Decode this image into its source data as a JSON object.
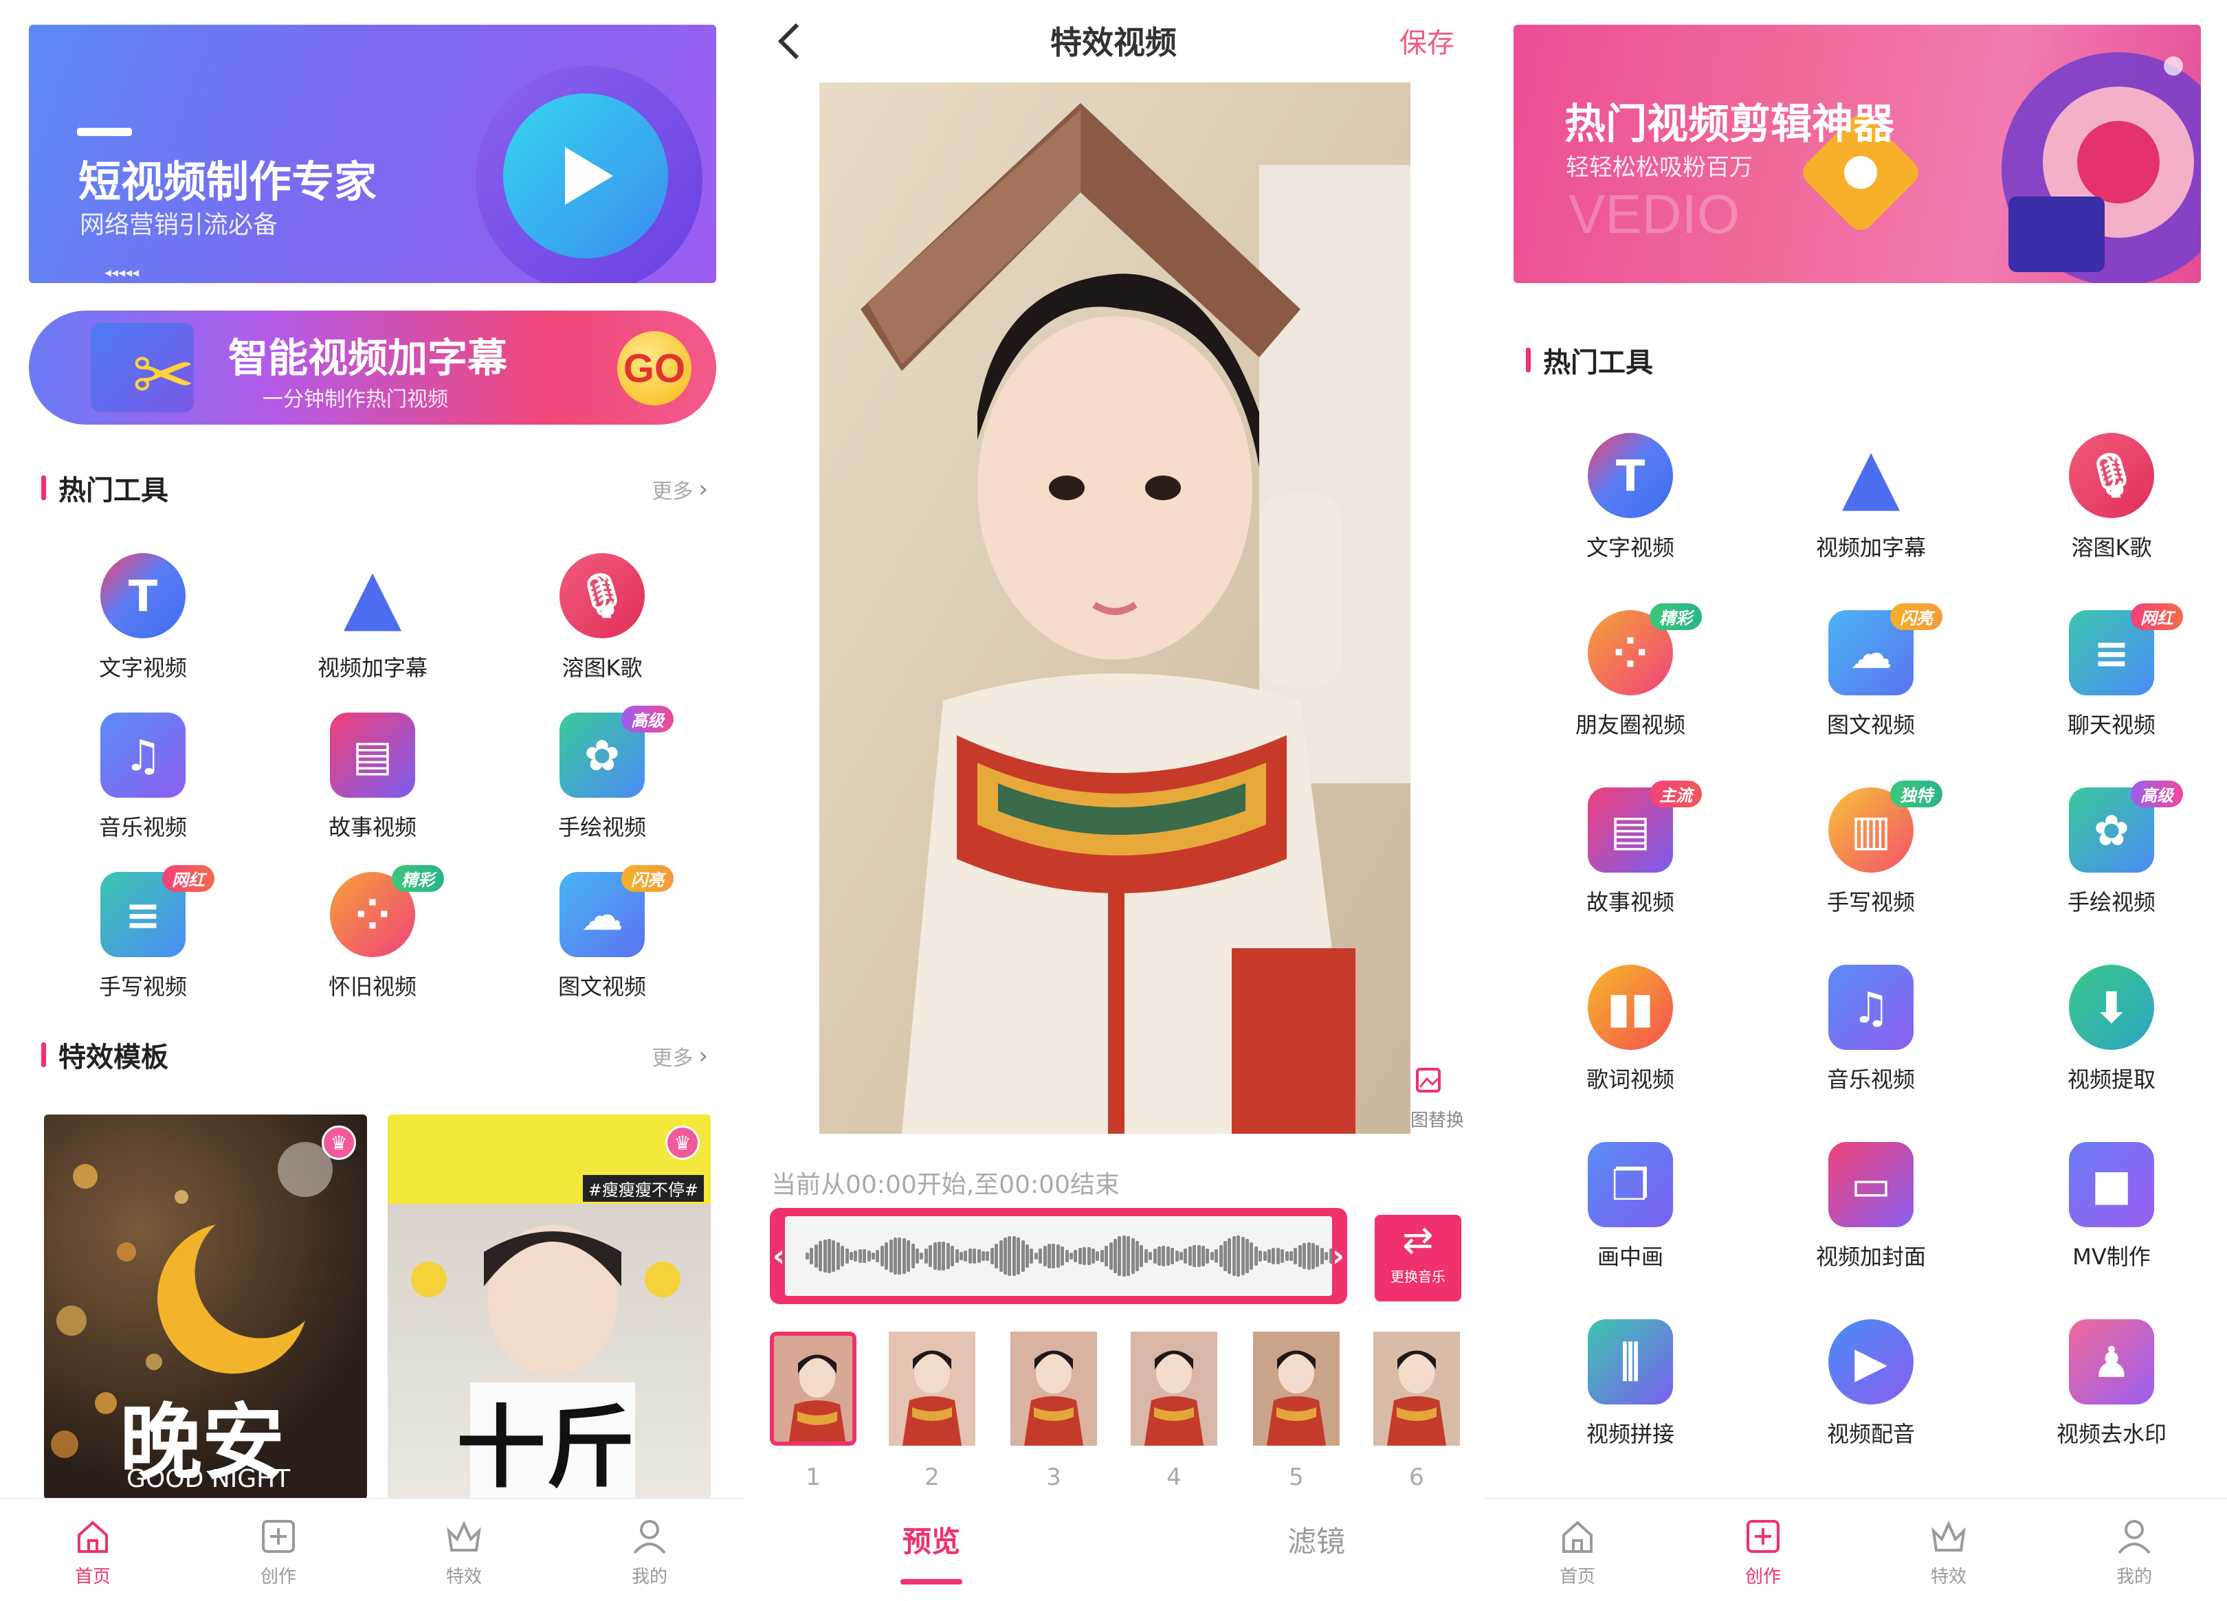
{
  "colors": {
    "accent": "#f0316b",
    "text": "#222222",
    "muted": "#999999"
  },
  "left": {
    "banner": {
      "title": "短视频制作专家",
      "subtitle": "网络营销引流必备",
      "arrows": "◂◂◂◂◂"
    },
    "subtitle_button": {
      "title": "智能视频加字幕",
      "subtitle": "一分钟制作热门视频",
      "go": "GO"
    },
    "hot_tools": {
      "title": "热门工具",
      "more": "更多",
      "items": [
        {
          "label": "文字视频",
          "icon": "text-icon"
        },
        {
          "label": "视频加字幕",
          "icon": "subtitle-icon"
        },
        {
          "label": "溶图K歌",
          "icon": "karaoke-icon"
        },
        {
          "label": "音乐视频",
          "icon": "music-note-icon"
        },
        {
          "label": "故事视频",
          "icon": "book-icon"
        },
        {
          "label": "手绘视频",
          "icon": "paint-icon",
          "tag": "高级"
        },
        {
          "label": "手写视频",
          "icon": "list-icon",
          "tag": "网红"
        },
        {
          "label": "怀旧视频",
          "icon": "grid-icon",
          "tag": "精彩"
        },
        {
          "label": "图文视频",
          "icon": "cloud-icon",
          "tag": "闪亮"
        }
      ]
    },
    "templates": {
      "title": "特效模板",
      "more": "更多",
      "cards": [
        {
          "big": "晚安",
          "small": "GOOD NIGHT"
        },
        {
          "big": "十斤",
          "tag": "#瘦瘦瘦不停#"
        }
      ]
    },
    "tabbar": [
      {
        "label": "首页",
        "icon": "home-icon",
        "active": true
      },
      {
        "label": "创作",
        "icon": "create-icon",
        "active": false
      },
      {
        "label": "特效",
        "icon": "crown-icon",
        "active": false
      },
      {
        "label": "我的",
        "icon": "user-icon",
        "active": false
      }
    ]
  },
  "middle": {
    "title": "特效视频",
    "save": "保存",
    "replace": "图替换",
    "time_text": "当前从00:00开始,至00:00结束",
    "swap_music": "更换音乐",
    "thumbs": [
      "1",
      "2",
      "3",
      "4",
      "5",
      "6"
    ],
    "selected_thumb": "1",
    "tabs": [
      {
        "label": "预览",
        "active": true
      },
      {
        "label": "滤镜",
        "active": false
      }
    ]
  },
  "right": {
    "banner": {
      "title": "热门视频剪辑神器",
      "subtitle": "轻轻松松吸粉百万",
      "watermark": "VEDIO"
    },
    "hot_tools": {
      "title": "热门工具",
      "items": [
        {
          "label": "文字视频",
          "icon": "text-icon"
        },
        {
          "label": "视频加字幕",
          "icon": "subtitle-icon"
        },
        {
          "label": "溶图K歌",
          "icon": "karaoke-icon"
        },
        {
          "label": "朋友圈视频",
          "icon": "grid-icon",
          "tag": "精彩"
        },
        {
          "label": "图文视频",
          "icon": "cloud-icon",
          "tag": "闪亮"
        },
        {
          "label": "聊天视频",
          "icon": "list-icon",
          "tag": "网红"
        },
        {
          "label": "故事视频",
          "icon": "book-icon",
          "tag": "主流"
        },
        {
          "label": "手写视频",
          "icon": "bars-icon",
          "tag": "独特"
        },
        {
          "label": "手绘视频",
          "icon": "paint-icon",
          "tag": "高级"
        },
        {
          "label": "歌词视频",
          "icon": "lyrics-icon"
        },
        {
          "label": "音乐视频",
          "icon": "music-note-icon"
        },
        {
          "label": "视频提取",
          "icon": "download-icon"
        },
        {
          "label": "画中画",
          "icon": "pip-icon"
        },
        {
          "label": "视频加封面",
          "icon": "cover-icon"
        },
        {
          "label": "MV制作",
          "icon": "camera-icon"
        },
        {
          "label": "视频拼接",
          "icon": "splice-icon"
        },
        {
          "label": "视频配音",
          "icon": "dub-icon"
        },
        {
          "label": "视频去水印",
          "icon": "watermark-icon"
        }
      ]
    },
    "tabbar": [
      {
        "label": "首页",
        "icon": "home-icon",
        "active": false
      },
      {
        "label": "创作",
        "icon": "create-icon",
        "active": true
      },
      {
        "label": "特效",
        "icon": "crown-icon",
        "active": false
      },
      {
        "label": "我的",
        "icon": "user-icon",
        "active": false
      }
    ]
  }
}
